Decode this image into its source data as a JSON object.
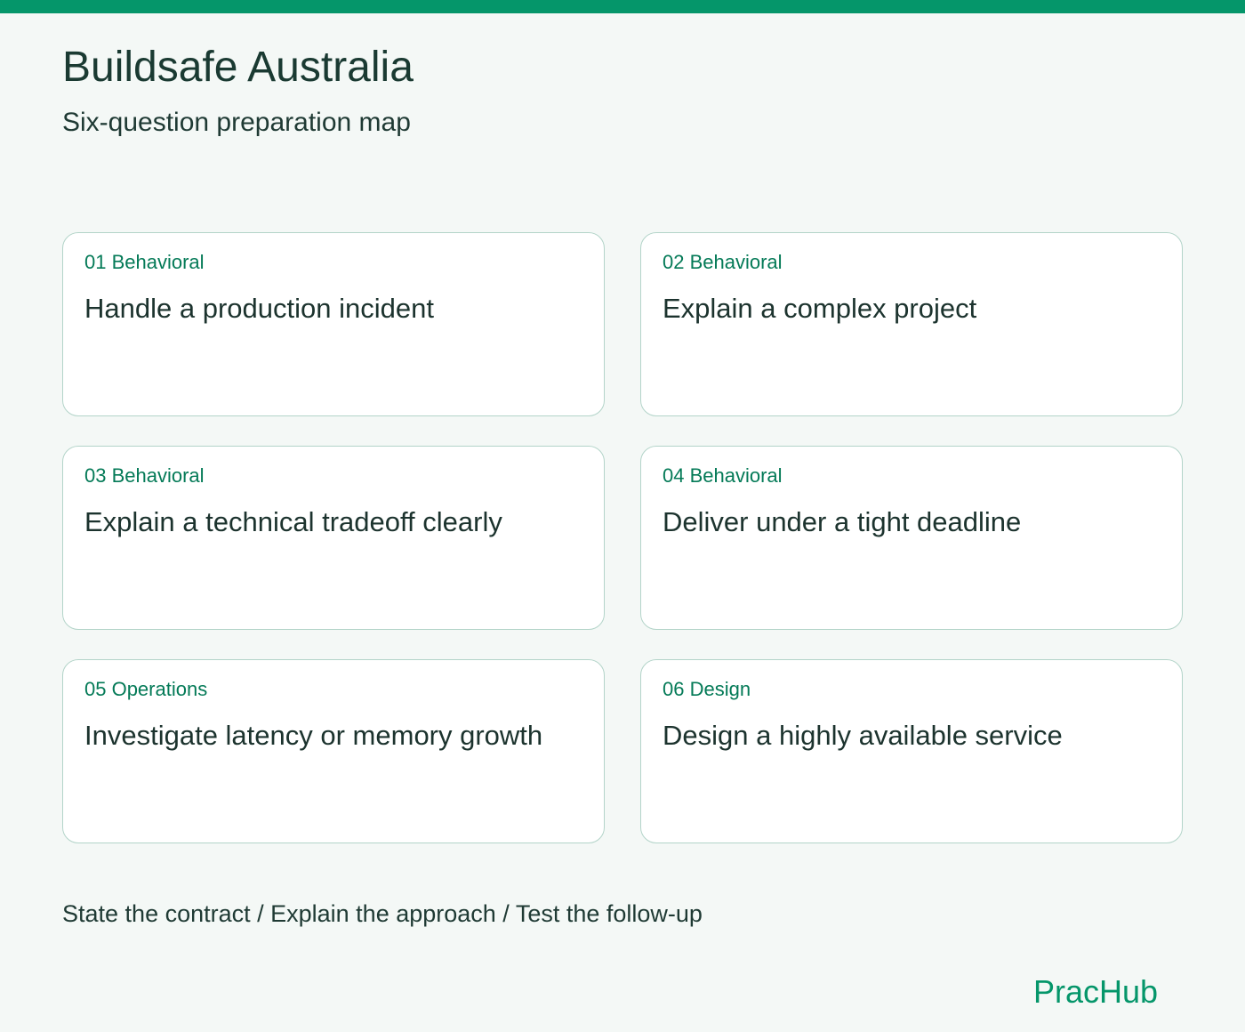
{
  "header": {
    "title": "Buildsafe Australia",
    "subtitle": "Six-question preparation map"
  },
  "cards": [
    {
      "tag": "01 Behavioral",
      "title": "Handle a production incident"
    },
    {
      "tag": "02 Behavioral",
      "title": "Explain a complex project"
    },
    {
      "tag": "03 Behavioral",
      "title": "Explain a technical tradeoff clearly"
    },
    {
      "tag": "04 Behavioral",
      "title": "Deliver under a tight deadline"
    },
    {
      "tag": "05 Operations",
      "title": "Investigate latency or memory growth"
    },
    {
      "tag": "06 Design",
      "title": "Design a highly available service"
    }
  ],
  "footer": {
    "steps": "State the contract / Explain the approach / Test the follow-up",
    "brand": "PracHub"
  },
  "colors": {
    "accent": "#05966a",
    "background": "#f4f8f6",
    "card_border": "#b3d4c9",
    "tag_text": "#047a57"
  }
}
